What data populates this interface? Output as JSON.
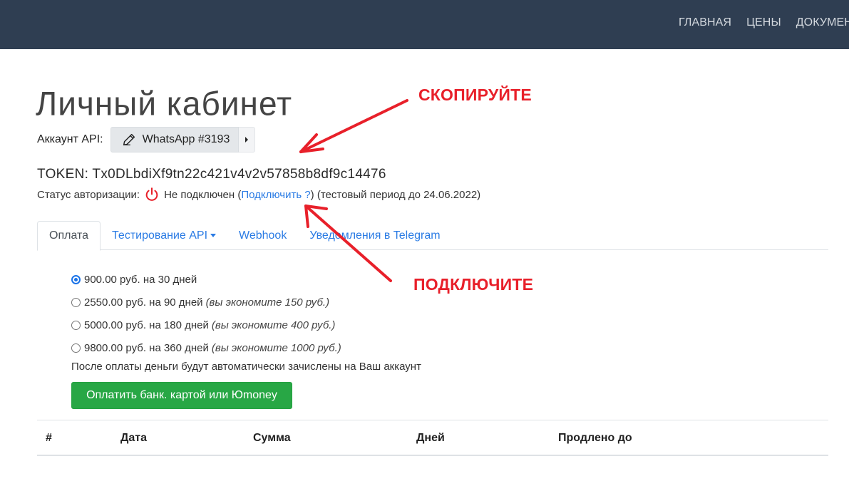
{
  "nav": {
    "items": [
      "ГЛАВНАЯ",
      "ЦЕНЫ",
      "ДОКУМЕНТ"
    ]
  },
  "page": {
    "title": "Личный кабинет"
  },
  "account": {
    "label": "Аккаунт API:",
    "selected": "WhatsApp #3193"
  },
  "token": {
    "text": "TOKEN: Tx0DLbdiXf9tn22c421v4v2v57858b8df9c14476"
  },
  "status": {
    "label": "Статус авторизации:",
    "value": "Не подключен (",
    "link": "Подключить ?",
    "suffix": ") (тестовый период до 24.06.2022)"
  },
  "tabs": [
    {
      "label": "Оплата",
      "active": true
    },
    {
      "label": "Тестирование API",
      "dropdown": true
    },
    {
      "label": "Webhook"
    },
    {
      "label": "Уведомления в Telegram"
    }
  ],
  "payment": {
    "options": [
      {
        "text": "900.00 руб. на 30 дней",
        "note": "",
        "checked": true
      },
      {
        "text": "2550.00 руб. на 90 дней",
        "note": "(вы экономите 150 руб.)",
        "checked": false
      },
      {
        "text": "5000.00 руб. на 180 дней",
        "note": "(вы экономите 400 руб.)",
        "checked": false
      },
      {
        "text": "9800.00 руб. на 360 дней",
        "note": "(вы экономите 1000 руб.)",
        "checked": false
      }
    ],
    "note": "После оплаты деньги будут автоматически зачислены на Ваш аккаунт",
    "button": "Оплатить банк. картой или Юmoney"
  },
  "history": {
    "columns": [
      "#",
      "Дата",
      "Сумма",
      "Дней",
      "Продлено до"
    ]
  },
  "annotations": {
    "copy": "СКОПИРУЙТЕ",
    "connect": "ПОДКЛЮЧИТЕ",
    "color": "#e8202a"
  },
  "colors": {
    "navbar": "#2f3e52",
    "link": "#2a7be4",
    "success": "#28a745",
    "power_icon": "#e8202a"
  }
}
